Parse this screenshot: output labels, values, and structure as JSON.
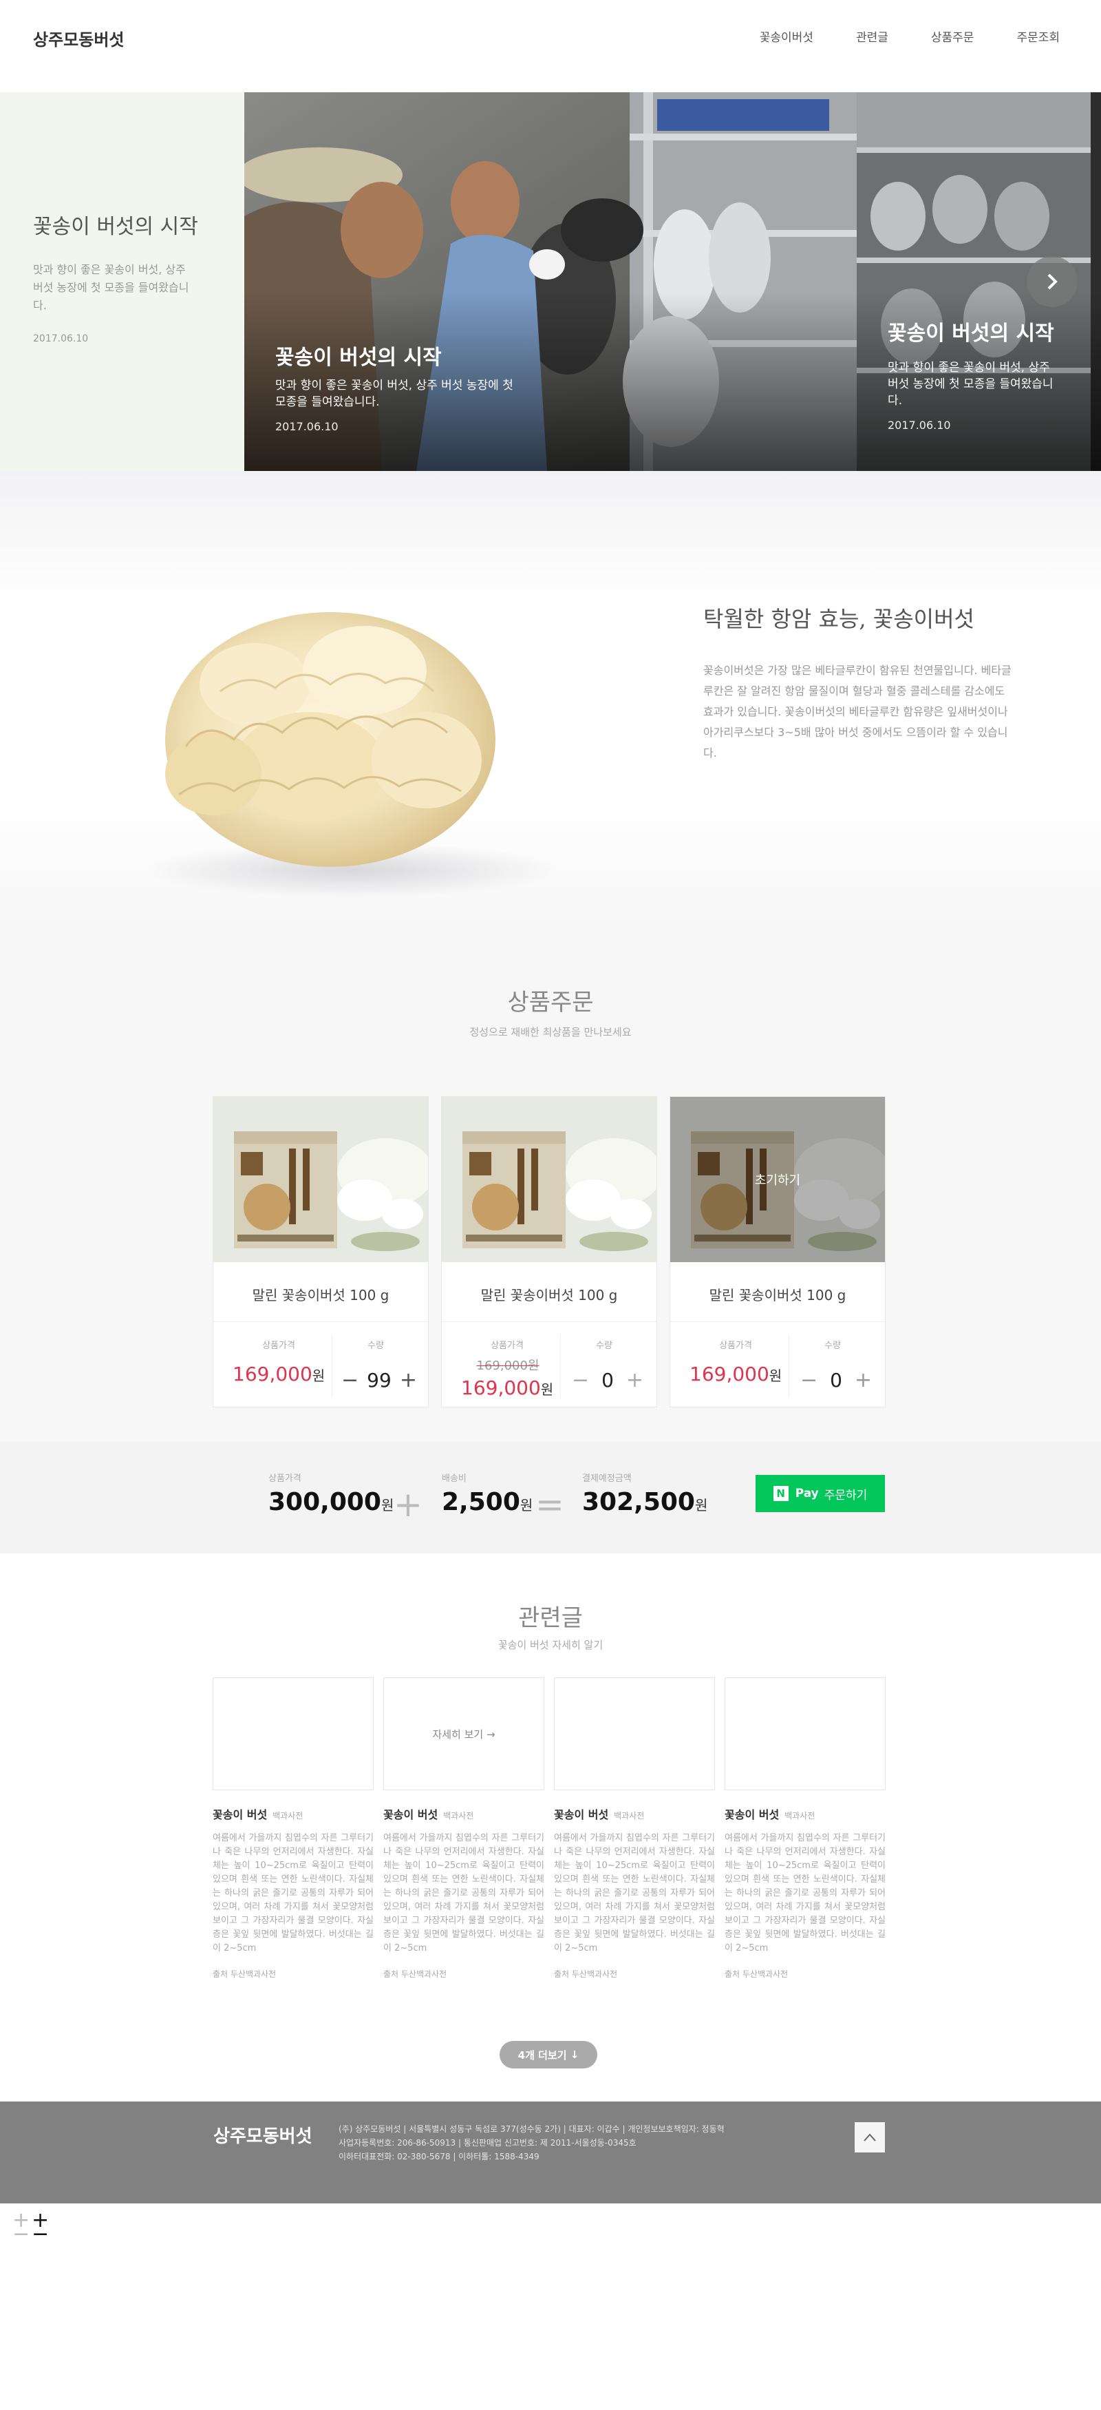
{
  "header": {
    "logo": "상주모동버섯",
    "nav": [
      "꽃송이버섯",
      "관련글",
      "상품주문",
      "주문조회"
    ]
  },
  "hero": {
    "panel": {
      "title": "꽃송이 버섯의 시작",
      "desc": "맛과 향이 좋은 꽃송이 버섯, 상주 버섯 농장에 첫 모종을 들여왔습니다.",
      "date": "2017.06.10"
    },
    "slides": [
      {
        "title": "꽃송이 버섯의 시작",
        "desc": "맛과 향이 좋은 꽃송이 버섯, 상주 버섯 농장에 첫 모종을 들여왔습니다.",
        "date": "2017.06.10"
      },
      {
        "title": "꽃송이 버섯의 시작",
        "desc": "맛과 향이 좋은 꽃송이 버섯, 상주 버섯 농장에 첫 모종을 들여왔습니다.",
        "date": "2017.06.10"
      }
    ]
  },
  "feature": {
    "title": "탁월한 항암 효능, 꽃송이버섯",
    "desc": "꽃송이버섯은 가장 많은 베타글루칸이 함유된 천연물입니다. 베타글루칸은 잘 알려진 항암 물질이며 혈당과 혈중 콜레스테롤 감소에도 효과가 있습니다. 꽃송이버섯의 베타글루칸 함유량은 잎새버섯이나 아가리쿠스보다 3~5배 많아 버섯 중에서도 으뜸이라 할 수 있습니다."
  },
  "order": {
    "title": "상품주문",
    "subtitle": "정성으로 재배한 최상품을 만나보세요",
    "price_label": "상품가격",
    "qty_label": "수량",
    "won": "원",
    "init_label": "초기하기",
    "products": [
      {
        "name": "말린 꽃송이버섯 100 g",
        "old_price": "",
        "price": "169,000",
        "qty": "99"
      },
      {
        "name": "말린 꽃송이버섯 100 g",
        "old_price": "169,000원",
        "price": "169,000",
        "qty": "0"
      },
      {
        "name": "말린 꽃송이버섯 100 g",
        "old_price": "",
        "price": "169,000",
        "qty": "0"
      }
    ],
    "totals": {
      "goods_label": "상품가격",
      "goods": "300,000",
      "ship_label": "배송비",
      "ship": "2,500",
      "sum_label": "결제예정금액",
      "sum": "302,500"
    },
    "npay": {
      "n": "N",
      "pay": "Pay",
      "label": "주문하기"
    }
  },
  "related": {
    "title": "관련글",
    "subtitle": "꽃송이 버섯 자세히 알기",
    "more_link": "자세히 보기",
    "load_more": "4개 더보기",
    "cards": [
      {
        "title": "꽃송이 버섯",
        "source": "백과사전",
        "body": "여름에서 가을까지 침엽수의 자른 그루터기나 죽은 나무의 언저리에서 자생한다. 자실체는 높이 10~25cm로 육질이고 탄력이 있으며 흰색 또는 연한 노란색이다. 자실체는 하나의 굵은 줄기로 공통의 자루가 되어 있으며, 여러 차례 가지를 쳐서 꽃모양처럼 보이고 그 가장자리가 물결 모양이다. 자실층은 꽃잎 뒷면에 발달하였다. 버섯대는 길이 2~5cm",
        "foot": "출처 두산백과사전"
      },
      {
        "title": "꽃송이 버섯",
        "source": "백과사전",
        "body": "여름에서 가을까지 침엽수의 자른 그루터기나 죽은 나무의 언저리에서 자생한다. 자실체는 높이 10~25cm로 육질이고 탄력이 있으며 흰색 또는 연한 노란색이다. 자실체는 하나의 굵은 줄기로 공통의 자루가 되어 있으며, 여러 차례 가지를 쳐서 꽃모양처럼 보이고 그 가장자리가 물결 모양이다. 자실층은 꽃잎 뒷면에 발달하였다. 버섯대는 길이 2~5cm",
        "foot": "출처 두산백과사전"
      },
      {
        "title": "꽃송이 버섯",
        "source": "백과사전",
        "body": "여름에서 가을까지 침엽수의 자른 그루터기나 죽은 나무의 언저리에서 자생한다. 자실체는 높이 10~25cm로 육질이고 탄력이 있으며 흰색 또는 연한 노란색이다. 자실체는 하나의 굵은 줄기로 공통의 자루가 되어 있으며, 여러 차례 가지를 쳐서 꽃모양처럼 보이고 그 가장자리가 물결 모양이다. 자실층은 꽃잎 뒷면에 발달하였다. 버섯대는 길이 2~5cm",
        "foot": "출처 두산백과사전"
      },
      {
        "title": "꽃송이 버섯",
        "source": "백과사전",
        "body": "여름에서 가을까지 침엽수의 자른 그루터기나 죽은 나무의 언저리에서 자생한다. 자실체는 높이 10~25cm로 육질이고 탄력이 있으며 흰색 또는 연한 노란색이다. 자실체는 하나의 굵은 줄기로 공통의 자루가 되어 있으며, 여러 차례 가지를 쳐서 꽃모양처럼 보이고 그 가장자리가 물결 모양이다. 자실층은 꽃잎 뒷면에 발달하였다. 버섯대는 길이 2~5cm",
        "foot": "출처 두산백과사전"
      }
    ]
  },
  "footer": {
    "logo": "상주모동버섯",
    "line1": "(주) 상주모동버섯  |  서울특별시 성동구 독섬로 377(성수동 2가)  |  대표자: 이갑수  |  개인정보보호책임자: 정동혁",
    "line2": "사업자등록번호: 206-86-50913  |  통신판매업 신고번호: 제 2011-서울성동-0345호",
    "line3": "이하터대표전화: 02-380-5678  |  이하터톨: 1588-4349"
  },
  "colors": {
    "accent_red": "#e2334b",
    "npay_green": "#03c75a",
    "footer_gray": "#818181"
  }
}
